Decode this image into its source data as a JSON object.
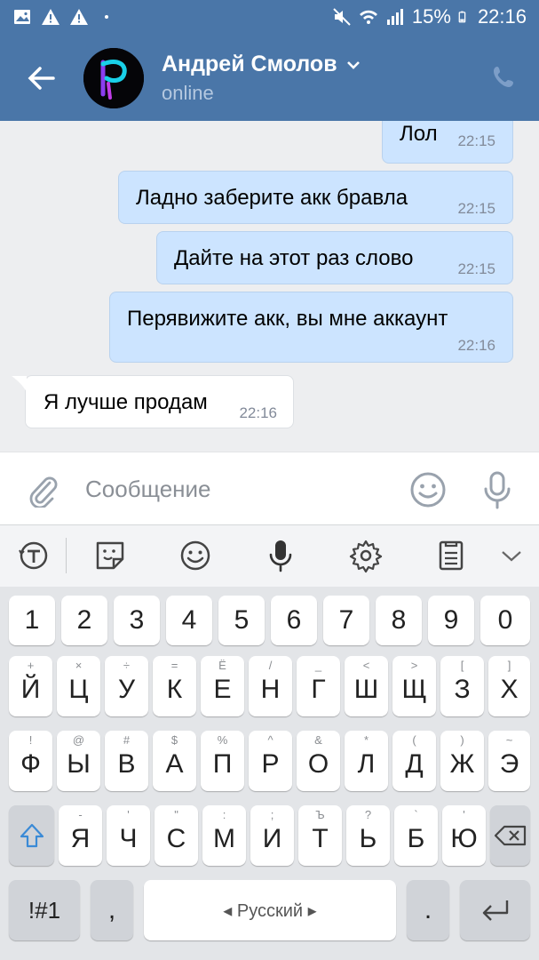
{
  "status_bar": {
    "battery": "15%",
    "time": "22:16"
  },
  "header": {
    "name": "Андрей Смолов",
    "status": "online",
    "accent": "#4a76a8"
  },
  "messages": [
    {
      "text": "Лол",
      "time": "22:15"
    },
    {
      "text": "Ладно заберите акк бравла",
      "time": "22:15"
    },
    {
      "text": "Дайте на этот раз слово",
      "time": "22:15"
    },
    {
      "text": "Перявижите акк, вы мне аккаунт",
      "time": "22:16"
    },
    {
      "text": "Я лучше продам",
      "time": "22:16"
    }
  ],
  "composer": {
    "placeholder": "Сообщение"
  },
  "keyboard": {
    "numbers": [
      "1",
      "2",
      "3",
      "4",
      "5",
      "6",
      "7",
      "8",
      "9",
      "0"
    ],
    "row1": [
      "Й",
      "Ц",
      "У",
      "К",
      "Е",
      "Н",
      "Г",
      "Ш",
      "Щ",
      "З",
      "Х"
    ],
    "row1_sup": [
      "+",
      "×",
      "÷",
      "=",
      "Ё",
      "/",
      "_",
      "<",
      ">",
      "[",
      "]"
    ],
    "row2": [
      "Ф",
      "Ы",
      "В",
      "А",
      "П",
      "Р",
      "О",
      "Л",
      "Д",
      "Ж",
      "Э"
    ],
    "row2_sup": [
      "!",
      "@",
      "#",
      "$",
      "%",
      "^",
      "&",
      "*",
      "(",
      ")",
      "~"
    ],
    "row3": [
      "Я",
      "Ч",
      "С",
      "М",
      "И",
      "Т",
      "Ь",
      "Б",
      "Ю"
    ],
    "row3_sup": [
      "-",
      "'",
      "\"",
      ":",
      ";",
      "Ъ",
      "?",
      "`",
      "'"
    ],
    "symbols_key": "!#1",
    "comma_key": ",",
    "space_key": "◂  Русский  ▸",
    "period_key": "."
  }
}
